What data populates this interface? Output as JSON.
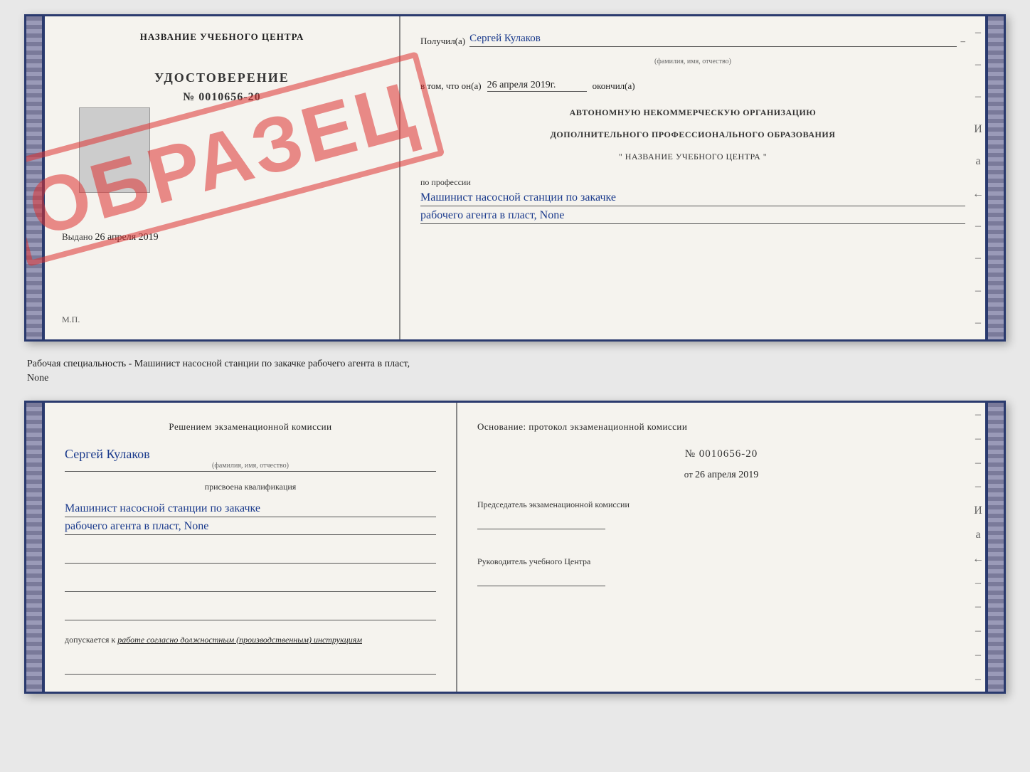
{
  "top_doc": {
    "left": {
      "title": "НАЗВАНИЕ УЧЕБНОГО ЦЕНТРА",
      "cert_label": "УДОСТОВЕРЕНИЕ",
      "cert_number": "№ 0010656-20",
      "issued_label": "Выдано",
      "issued_date": "26 апреля 2019",
      "mp_label": "М.П."
    },
    "stamp": "ОБРАЗЕЦ",
    "right": {
      "received_label": "Получил(а)",
      "received_name": "Сергей Кулаков",
      "name_sublabel": "(фамилия, имя, отчество)",
      "date_label": "в том, что он(а)",
      "date_value": "26 апреля 2019г.",
      "finished_label": "окончил(а)",
      "org_line1": "АВТОНОМНУЮ НЕКОММЕРЧЕСКУЮ ОРГАНИЗАЦИЮ",
      "org_line2": "ДОПОЛНИТЕЛЬНОГО ПРОФЕССИОНАЛЬНОГО ОБРАЗОВАНИЯ",
      "org_line3": "\"  НАЗВАНИЕ УЧЕБНОГО ЦЕНТРА  \"",
      "profession_label": "по профессии",
      "profession_line1": "Машинист насосной станции по закачке",
      "profession_line2": "рабочего агента в пласт, None",
      "side_dashes": [
        "–",
        "–",
        "–",
        "И",
        "а",
        "←",
        "–",
        "–",
        "–",
        "–"
      ]
    }
  },
  "middle": {
    "text_line1": "Рабочая специальность - Машинист насосной станции по закачке рабочего агента в пласт,",
    "text_line2": "None"
  },
  "bottom_doc": {
    "left": {
      "decision_text": "Решением экзаменационной комиссии",
      "person_name": "Сергей Кулаков",
      "name_sublabel": "(фамилия, имя, отчество)",
      "assigned_label": "присвоена квалификация",
      "qualification_line1": "Машинист насосной станции по закачке",
      "qualification_line2": "рабочего агента в пласт, None",
      "blank_lines": 3,
      "admission_label": "допускается к",
      "admission_value": "работе согласно должностным (производственным) инструкциям"
    },
    "right": {
      "basis_label": "Основание: протокол экзаменационной комиссии",
      "protocol_number": "№ 0010656-20",
      "date_prefix": "от",
      "date_value": "26 апреля 2019",
      "chairman_label": "Председатель экзаменационной комиссии",
      "head_label": "Руководитель учебного Центра",
      "side_dashes": [
        "–",
        "–",
        "–",
        "–",
        "И",
        "а",
        "←",
        "–",
        "–",
        "–",
        "–",
        "–"
      ]
    }
  }
}
